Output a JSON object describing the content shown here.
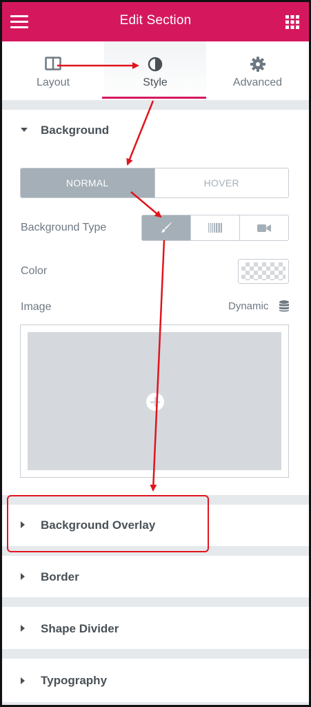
{
  "header": {
    "title": "Edit Section",
    "menu_icon": "hamburger-icon",
    "apps_icon": "grid-icon",
    "bg_color": "#d5185e"
  },
  "tabs": [
    {
      "label": "Layout",
      "icon": "layout-columns-icon",
      "active": false
    },
    {
      "label": "Style",
      "icon": "half-circle-contrast-icon",
      "active": true
    },
    {
      "label": "Advanced",
      "icon": "gear-icon",
      "active": false
    }
  ],
  "background": {
    "title": "Background",
    "expanded": true,
    "state_toggle": {
      "normal": "NORMAL",
      "hover": "HOVER",
      "selected": "NORMAL"
    },
    "type_label": "Background Type",
    "type_options": [
      "brush-icon",
      "gradient-icon",
      "video-camera-icon"
    ],
    "type_selected": "brush-icon",
    "color_label": "Color",
    "image_label": "Image",
    "dynamic_label": "Dynamic",
    "dynamic_icon": "database-icon"
  },
  "sections": [
    {
      "title": "Background Overlay",
      "highlighted": true
    },
    {
      "title": "Border"
    },
    {
      "title": "Shape Divider"
    },
    {
      "title": "Typography"
    }
  ],
  "colors": {
    "accent": "#d5185e",
    "annotation_red": "#e0141e",
    "toggle_active": "#a4afb7",
    "text": "#495157"
  }
}
